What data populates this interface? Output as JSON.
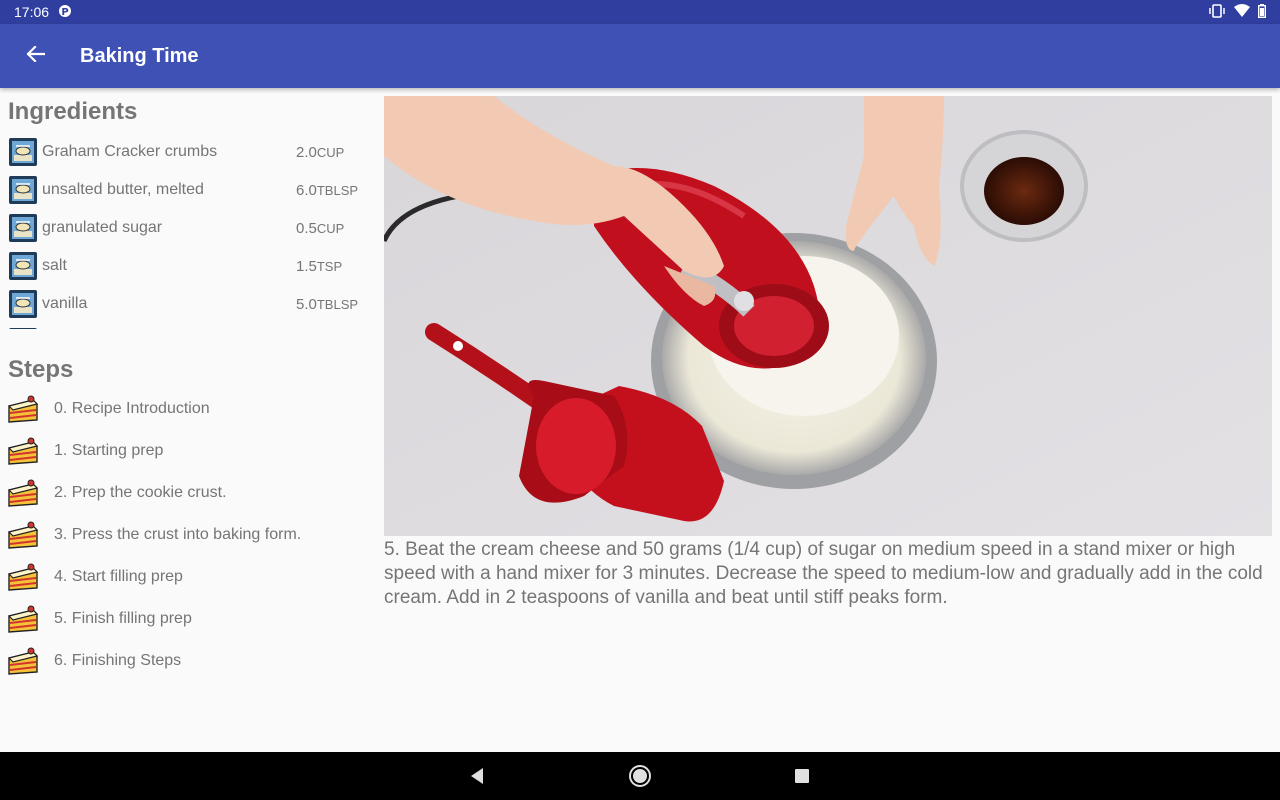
{
  "status_bar": {
    "time": "17:06",
    "notification_icon": "p-icon",
    "icons": [
      "vibrate-icon",
      "wifi-icon",
      "battery-icon"
    ]
  },
  "app_bar": {
    "title": "Baking Time",
    "back_icon": "arrow-back-icon"
  },
  "ingredients": {
    "title": "Ingredients",
    "items": [
      {
        "name": "Graham Cracker crumbs",
        "quantity": "2.0",
        "unit": "CUP"
      },
      {
        "name": "unsalted butter, melted",
        "quantity": "6.0",
        "unit": "TBLSP"
      },
      {
        "name": "granulated sugar",
        "quantity": "0.5",
        "unit": "CUP"
      },
      {
        "name": "salt",
        "quantity": "1.5",
        "unit": "TSP"
      },
      {
        "name": "vanilla",
        "quantity": "5.0",
        "unit": "TBLSP"
      }
    ]
  },
  "steps": {
    "title": "Steps",
    "items": [
      {
        "label": "0. Recipe Introduction"
      },
      {
        "label": "1. Starting prep"
      },
      {
        "label": "2. Prep the cookie crust."
      },
      {
        "label": "3. Press the crust into baking form."
      },
      {
        "label": "4. Start filling prep"
      },
      {
        "label": "5. Finish filling prep"
      },
      {
        "label": "6. Finishing Steps"
      }
    ]
  },
  "detail": {
    "description": "5. Beat the cream cheese and 50 grams (1/4 cup) of sugar on medium speed in a stand mixer or high speed with a hand mixer for 3 minutes. Decrease the speed to medium-low and gradually add in the cold cream. Add in 2 teaspoons of vanilla and beat until stiff peaks form."
  },
  "nav_bar": {
    "buttons": [
      "back-triangle-icon",
      "home-circle-icon",
      "recents-square-icon"
    ]
  },
  "colors": {
    "status_bar": "#303f9f",
    "app_bar": "#3f51b5",
    "text_secondary": "#757575",
    "background": "#fafafa"
  }
}
